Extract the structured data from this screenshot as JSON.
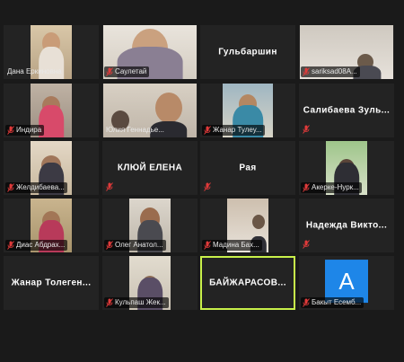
{
  "meeting": {
    "accent_color": "#c8f04a",
    "muted_icon": "mic-muted-icon",
    "tiles": [
      {
        "name": "Дана Еркиновна",
        "mode": "video",
        "muted": false
      },
      {
        "name": "Саулетай",
        "mode": "video",
        "muted": true
      },
      {
        "name": "Гульбаршин",
        "mode": "name",
        "muted": false
      },
      {
        "name": "sariksad08A...",
        "mode": "video",
        "muted": true
      },
      {
        "name": "Индира",
        "mode": "video",
        "muted": true
      },
      {
        "name": "Юлия Геннадье...",
        "mode": "video",
        "muted": false
      },
      {
        "name": "Жанар Тулеу...",
        "mode": "video",
        "muted": true
      },
      {
        "name": "Салибаева Зуль...",
        "mode": "name",
        "muted": true
      },
      {
        "name": "Желдибаева...",
        "mode": "video",
        "muted": true
      },
      {
        "name": "КЛЮЙ ЕЛЕНА",
        "mode": "name",
        "muted": true
      },
      {
        "name": "Рая",
        "mode": "name",
        "muted": true
      },
      {
        "name": "Акерке-Нурк...",
        "mode": "video",
        "muted": true
      },
      {
        "name": "Диас Абдрах...",
        "mode": "video",
        "muted": true
      },
      {
        "name": "Олег Анатол...",
        "mode": "video",
        "muted": true
      },
      {
        "name": "Мадина Бах...",
        "mode": "video",
        "muted": true
      },
      {
        "name": "Надежда Викто...",
        "mode": "name",
        "muted": true
      },
      {
        "name": "Жанар Толеген...",
        "mode": "name",
        "muted": false
      },
      {
        "name": "Кульпаш Жек...",
        "mode": "video",
        "muted": true
      },
      {
        "name": "БАЙЖАРАСОВ...",
        "mode": "name",
        "muted": false,
        "active": true
      },
      {
        "name": "Бакыт Есемб...",
        "mode": "avatar",
        "muted": true,
        "avatar_letter": "A"
      }
    ]
  }
}
